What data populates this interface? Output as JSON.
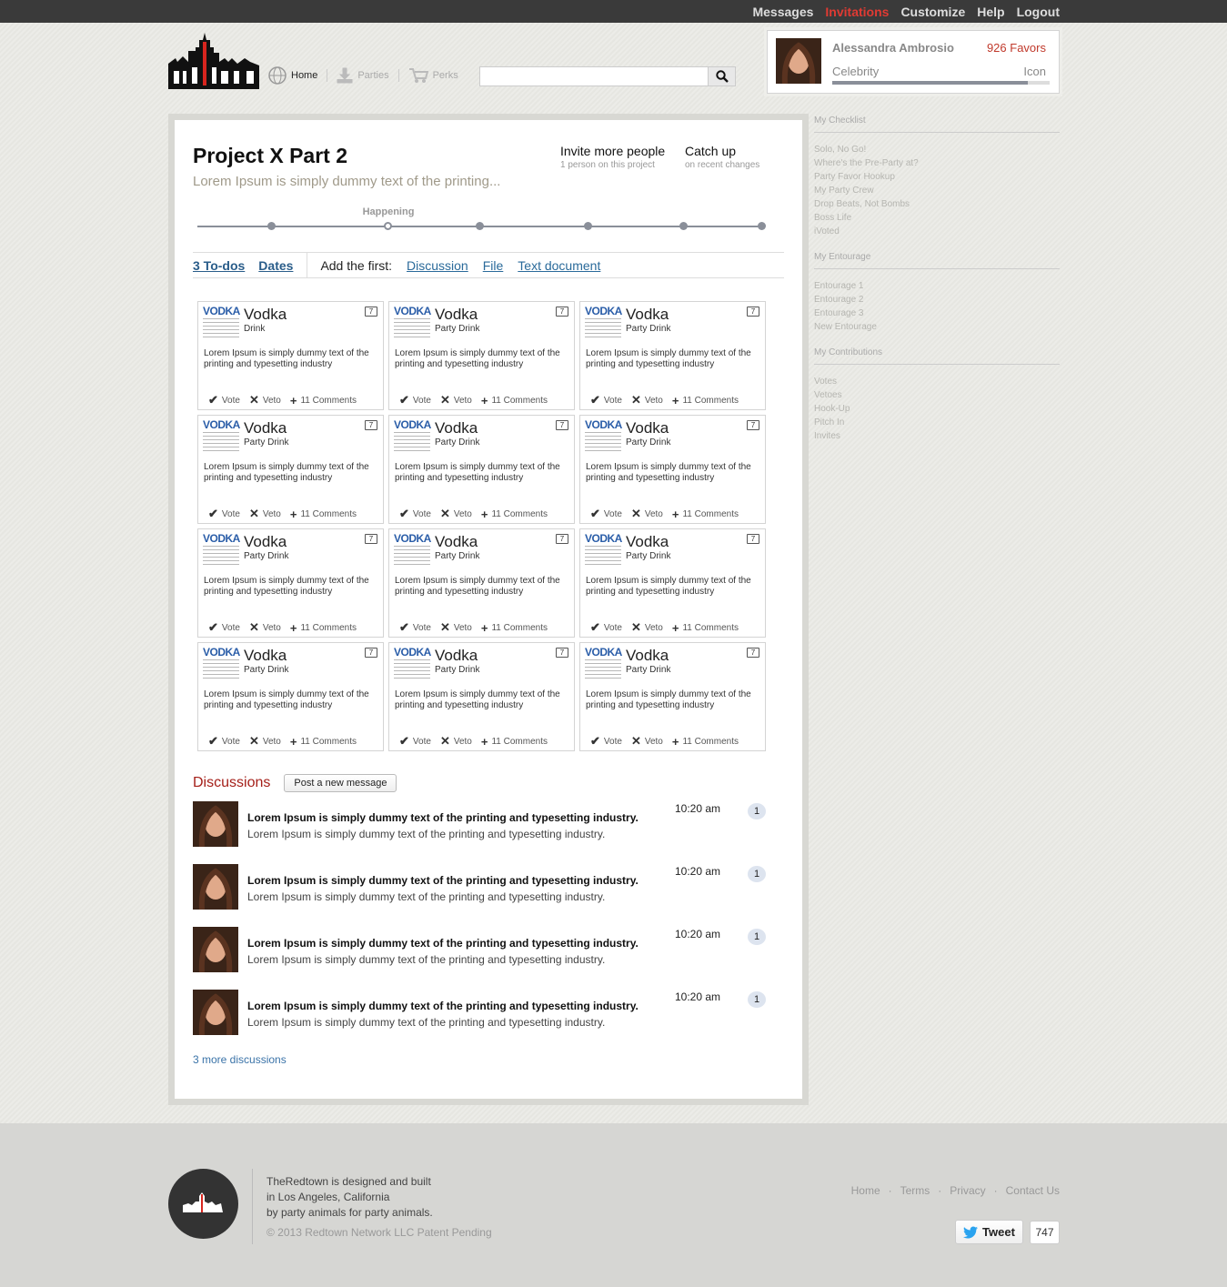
{
  "topbar": {
    "links": [
      "Messages",
      "Invitations",
      "Customize",
      "Help",
      "Logout"
    ],
    "active": "Invitations"
  },
  "nav": {
    "home": "Home",
    "parties": "Parties",
    "perks": "Perks"
  },
  "search": {
    "placeholder": ""
  },
  "profile": {
    "name": "Alessandra Ambrosio",
    "favors": "926 Favors",
    "level": "Celebrity",
    "next_level": "Icon",
    "progress": 0.9
  },
  "project": {
    "title": "Project X Part 2",
    "subtitle": "Lorem Ipsum is simply dummy text of the printing...",
    "invite": {
      "title": "Invite more people",
      "sub": "1 person on this project"
    },
    "catchup": {
      "title": "Catch up",
      "sub": "on recent changes"
    },
    "timeline_label": "Happening",
    "tabs": {
      "todos": "3 To-dos",
      "dates": "Dates",
      "add_first": "Add the first:",
      "discussion": "Discussion",
      "file": "File",
      "text_doc": "Text document"
    }
  },
  "cards": [
    {
      "brand": "VODKA",
      "title": "Vodka",
      "category": "Drink",
      "count": "7",
      "desc": "Lorem Ipsum is simply dummy text of the printing and typesetting industry",
      "vote": "Vote",
      "veto": "Veto",
      "comments": "11 Comments"
    },
    {
      "brand": "VODKA",
      "title": "Vodka",
      "category": "Party Drink",
      "count": "7",
      "desc": "Lorem Ipsum is simply dummy text of the printing and typesetting industry",
      "vote": "Vote",
      "veto": "Veto",
      "comments": "11 Comments"
    },
    {
      "brand": "VODKA",
      "title": "Vodka",
      "category": "Party Drink",
      "count": "7",
      "desc": "Lorem Ipsum is simply dummy text of the printing and typesetting industry",
      "vote": "Vote",
      "veto": "Veto",
      "comments": "11 Comments"
    },
    {
      "brand": "VODKA",
      "title": "Vodka",
      "category": "Party Drink",
      "count": "7",
      "desc": "Lorem Ipsum is simply dummy text of the printing and typesetting industry",
      "vote": "Vote",
      "veto": "Veto",
      "comments": "11 Comments"
    },
    {
      "brand": "VODKA",
      "title": "Vodka",
      "category": "Party Drink",
      "count": "7",
      "desc": "Lorem Ipsum is simply dummy text of the printing and typesetting industry",
      "vote": "Vote",
      "veto": "Veto",
      "comments": "11 Comments"
    },
    {
      "brand": "VODKA",
      "title": "Vodka",
      "category": "Party Drink",
      "count": "7",
      "desc": "Lorem Ipsum is simply dummy text of the printing and typesetting industry",
      "vote": "Vote",
      "veto": "Veto",
      "comments": "11 Comments"
    },
    {
      "brand": "VODKA",
      "title": "Vodka",
      "category": "Party Drink",
      "count": "7",
      "desc": "Lorem Ipsum is simply dummy text of the printing and typesetting industry",
      "vote": "Vote",
      "veto": "Veto",
      "comments": "11 Comments"
    },
    {
      "brand": "VODKA",
      "title": "Vodka",
      "category": "Party Drink",
      "count": "7",
      "desc": "Lorem Ipsum is simply dummy text of the printing and typesetting industry",
      "vote": "Vote",
      "veto": "Veto",
      "comments": "11 Comments"
    },
    {
      "brand": "VODKA",
      "title": "Vodka",
      "category": "Party Drink",
      "count": "7",
      "desc": "Lorem Ipsum is simply dummy text of the printing and typesetting industry",
      "vote": "Vote",
      "veto": "Veto",
      "comments": "11 Comments"
    },
    {
      "brand": "VODKA",
      "title": "Vodka",
      "category": "Party Drink",
      "count": "7",
      "desc": "Lorem Ipsum is simply dummy text of the printing and typesetting industry",
      "vote": "Vote",
      "veto": "Veto",
      "comments": "11 Comments"
    },
    {
      "brand": "VODKA",
      "title": "Vodka",
      "category": "Party Drink",
      "count": "7",
      "desc": "Lorem Ipsum is simply dummy text of the printing and typesetting industry",
      "vote": "Vote",
      "veto": "Veto",
      "comments": "11 Comments"
    },
    {
      "brand": "VODKA",
      "title": "Vodka",
      "category": "Party Drink",
      "count": "7",
      "desc": "Lorem Ipsum is simply dummy text of the printing and typesetting industry",
      "vote": "Vote",
      "veto": "Veto",
      "comments": "11 Comments"
    }
  ],
  "discussions": {
    "title": "Discussions",
    "post_button": "Post a new message",
    "items": [
      {
        "bold": "Lorem Ipsum is simply dummy text of the printing and typesetting industry.",
        "text": "Lorem Ipsum is simply dummy text of the printing and typesetting industry.",
        "time": "10:20 am",
        "count": "1"
      },
      {
        "bold": "Lorem Ipsum is simply dummy text of the printing and typesetting industry.",
        "text": "Lorem Ipsum is simply dummy text of the printing and typesetting industry.",
        "time": "10:20 am",
        "count": "1"
      },
      {
        "bold": "Lorem Ipsum is simply dummy text of the printing and typesetting industry.",
        "text": "Lorem Ipsum is simply dummy text of the printing and typesetting industry.",
        "time": "10:20 am",
        "count": "1"
      },
      {
        "bold": "Lorem Ipsum is simply dummy text of the printing and typesetting industry.",
        "text": "Lorem Ipsum is simply dummy text of the printing and typesetting industry.",
        "time": "10:20 am",
        "count": "1"
      }
    ],
    "more": "3 more discussions"
  },
  "sidebar": [
    {
      "title": "My Checklist",
      "items": [
        "Solo, No Go!",
        "Where's the Pre-Party at?",
        "Party Favor Hookup",
        "My Party Crew",
        "Drop Beats, Not Bombs",
        "Boss Life",
        "iVoted"
      ]
    },
    {
      "title": "My Entourage",
      "items": [
        "Entourage 1",
        "Entourage 2",
        "Entourage 3",
        "New Entourage"
      ]
    },
    {
      "title": "My Contributions",
      "items": [
        "Votes",
        "Vetoes",
        "Hook-Up",
        "Pitch In",
        "Invites"
      ]
    }
  ],
  "footer": {
    "about": [
      "TheRedtown is designed and built",
      "in Los Angeles, California",
      "by party animals for party animals."
    ],
    "copyright": "© 2013 Redtown Network LLC Patent Pending",
    "links": [
      "Home",
      "Terms",
      "Privacy",
      "Contact Us"
    ],
    "tweet_label": "Tweet",
    "tweet_count": "747"
  }
}
